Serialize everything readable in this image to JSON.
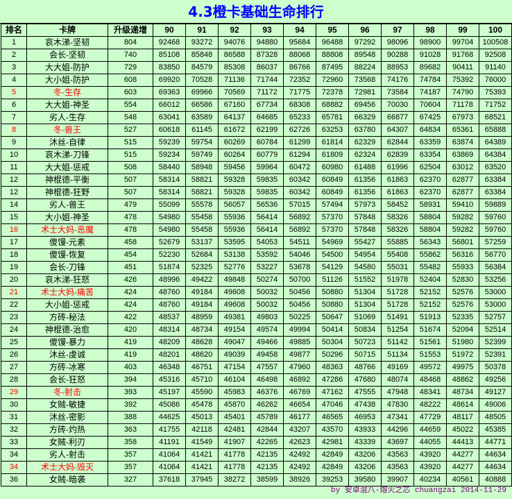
{
  "title": "4.3橙卡基础生命排行",
  "header": [
    "排名",
    "卡牌",
    "升级递增",
    "90",
    "91",
    "92",
    "93",
    "94",
    "95",
    "96",
    "97",
    "98",
    "99",
    "100"
  ],
  "rows": [
    {
      "rank": "1",
      "card": "哀木涕-坚韧",
      "inc": "804",
      "v": [
        "92468",
        "93272",
        "94076",
        "94880",
        "95684",
        "96488",
        "97292",
        "98096",
        "98900",
        "99704",
        "100508"
      ]
    },
    {
      "rank": "2",
      "card": "会长-坚韧",
      "inc": "740",
      "v": [
        "85108",
        "85848",
        "86588",
        "87328",
        "88068",
        "88808",
        "89548",
        "90288",
        "91028",
        "91768",
        "92508"
      ]
    },
    {
      "rank": "3",
      "card": "大大姐-防护",
      "inc": "729",
      "v": [
        "83850",
        "84579",
        "85308",
        "86037",
        "86766",
        "87495",
        "88224",
        "88953",
        "89682",
        "90411",
        "91140"
      ]
    },
    {
      "rank": "4",
      "card": "大小姐-防护",
      "inc": "608",
      "v": [
        "69920",
        "70528",
        "71136",
        "71744",
        "72352",
        "72960",
        "73568",
        "74176",
        "74784",
        "75392",
        "76000"
      ]
    },
    {
      "rank": "5",
      "card": "冬-生存",
      "inc": "603",
      "v": [
        "69363",
        "69966",
        "70569",
        "71172",
        "71775",
        "72378",
        "72981",
        "73584",
        "74187",
        "74790",
        "75393"
      ],
      "red": true
    },
    {
      "rank": "6",
      "card": "大大姐-神圣",
      "inc": "554",
      "v": [
        "66012",
        "66586",
        "67160",
        "67734",
        "68308",
        "68882",
        "69456",
        "70030",
        "70604",
        "71178",
        "71752"
      ]
    },
    {
      "rank": "7",
      "card": "劣人-生存",
      "inc": "548",
      "v": [
        "63041",
        "63589",
        "64137",
        "64685",
        "65233",
        "65781",
        "66329",
        "66877",
        "67425",
        "67973",
        "68521"
      ]
    },
    {
      "rank": "8",
      "card": "冬-兽王",
      "inc": "527",
      "v": [
        "60618",
        "61145",
        "61672",
        "62199",
        "62726",
        "63253",
        "63780",
        "64307",
        "64834",
        "65361",
        "65888"
      ],
      "red": true
    },
    {
      "rank": "9",
      "card": "沐丝-自律",
      "inc": "515",
      "v": [
        "59239",
        "59754",
        "60269",
        "60784",
        "61299",
        "61814",
        "62329",
        "62844",
        "63359",
        "63874",
        "64389"
      ]
    },
    {
      "rank": "10",
      "card": "哀木涕-刀锋",
      "inc": "515",
      "v": [
        "59234",
        "59749",
        "60264",
        "60779",
        "61294",
        "61809",
        "62324",
        "62839",
        "63354",
        "63869",
        "64384"
      ]
    },
    {
      "rank": "11",
      "card": "大大姐-惩戒",
      "inc": "508",
      "v": [
        "58440",
        "58948",
        "59456",
        "59964",
        "60472",
        "60980",
        "61488",
        "61996",
        "62504",
        "63012",
        "63520"
      ]
    },
    {
      "rank": "12",
      "card": "神棍德-平衡",
      "inc": "507",
      "v": [
        "58314",
        "58821",
        "59328",
        "59835",
        "60342",
        "60849",
        "61356",
        "61863",
        "62370",
        "62877",
        "63384"
      ]
    },
    {
      "rank": "12",
      "card": "神棍德-狂野",
      "inc": "507",
      "v": [
        "58314",
        "58821",
        "59328",
        "59835",
        "60342",
        "60849",
        "61356",
        "61863",
        "62370",
        "62877",
        "63384"
      ]
    },
    {
      "rank": "14",
      "card": "劣人-兽王",
      "inc": "479",
      "v": [
        "55099",
        "55578",
        "56057",
        "56536",
        "57015",
        "57494",
        "57973",
        "58452",
        "58931",
        "59410",
        "59889"
      ]
    },
    {
      "rank": "15",
      "card": "大小姐-神圣",
      "inc": "478",
      "v": [
        "54980",
        "55458",
        "55936",
        "56414",
        "56892",
        "57370",
        "57848",
        "58326",
        "58804",
        "59282",
        "59760"
      ]
    },
    {
      "rank": "16",
      "card": "术士大妈-恶魔",
      "inc": "478",
      "v": [
        "54980",
        "55458",
        "55936",
        "56414",
        "56892",
        "57370",
        "57848",
        "58326",
        "58804",
        "59282",
        "59760"
      ],
      "red": true
    },
    {
      "rank": "17",
      "card": "傻馒-元素",
      "inc": "458",
      "v": [
        "52679",
        "53137",
        "53595",
        "54053",
        "54511",
        "54969",
        "55427",
        "55885",
        "56343",
        "56801",
        "57259"
      ]
    },
    {
      "rank": "18",
      "card": "傻馒-恢复",
      "inc": "454",
      "v": [
        "52230",
        "52684",
        "53138",
        "53592",
        "54046",
        "54500",
        "54954",
        "55408",
        "55862",
        "56316",
        "56770"
      ]
    },
    {
      "rank": "19",
      "card": "会长-刀锋",
      "inc": "451",
      "v": [
        "51874",
        "52325",
        "52776",
        "53227",
        "53678",
        "54129",
        "54580",
        "55031",
        "55482",
        "55933",
        "56384"
      ]
    },
    {
      "rank": "20",
      "card": "哀木涕-狂怒",
      "inc": "426",
      "v": [
        "48996",
        "49422",
        "49848",
        "50274",
        "50700",
        "51126",
        "51552",
        "51978",
        "52404",
        "52830",
        "53256"
      ]
    },
    {
      "rank": "21",
      "card": "术士大妈-痛苦",
      "inc": "424",
      "v": [
        "48760",
        "49184",
        "49608",
        "50032",
        "50456",
        "50880",
        "51304",
        "51728",
        "52152",
        "52576",
        "53000"
      ],
      "red": true
    },
    {
      "rank": "22",
      "card": "大小姐-惩戒",
      "inc": "424",
      "v": [
        "48760",
        "49184",
        "49608",
        "50032",
        "50456",
        "50880",
        "51304",
        "51728",
        "52152",
        "52576",
        "53000"
      ]
    },
    {
      "rank": "23",
      "card": "方砖-秘法",
      "inc": "422",
      "v": [
        "48537",
        "48959",
        "49381",
        "49803",
        "50225",
        "50647",
        "51069",
        "51491",
        "51913",
        "52335",
        "52757"
      ]
    },
    {
      "rank": "24",
      "card": "神棍德-治愈",
      "inc": "420",
      "v": [
        "48314",
        "48734",
        "49154",
        "49574",
        "49994",
        "50414",
        "50834",
        "51254",
        "51674",
        "52094",
        "52514"
      ]
    },
    {
      "rank": "25",
      "card": "傻馒-暴力",
      "inc": "419",
      "v": [
        "48209",
        "48628",
        "49047",
        "49466",
        "49885",
        "50304",
        "50723",
        "51142",
        "51561",
        "51980",
        "52399"
      ]
    },
    {
      "rank": "26",
      "card": "沐丝-虔诚",
      "inc": "419",
      "v": [
        "48201",
        "48620",
        "49039",
        "49458",
        "49877",
        "50296",
        "50715",
        "51134",
        "51553",
        "51972",
        "52391"
      ]
    },
    {
      "rank": "27",
      "card": "方砖-冰寒",
      "inc": "403",
      "v": [
        "46348",
        "46751",
        "47154",
        "47557",
        "47960",
        "48363",
        "48766",
        "49169",
        "49572",
        "49975",
        "50378"
      ]
    },
    {
      "rank": "28",
      "card": "会长-狂怒",
      "inc": "394",
      "v": [
        "45316",
        "45710",
        "46104",
        "46498",
        "46892",
        "47286",
        "47680",
        "48074",
        "48468",
        "48862",
        "49256"
      ]
    },
    {
      "rank": "29",
      "card": "冬-射击",
      "inc": "393",
      "v": [
        "45197",
        "45590",
        "45983",
        "46376",
        "46769",
        "47162",
        "47555",
        "47948",
        "48341",
        "48734",
        "49127"
      ],
      "red": true
    },
    {
      "rank": "30",
      "card": "女贼-敏捷",
      "inc": "392",
      "v": [
        "45086",
        "45478",
        "45870",
        "46262",
        "46654",
        "47046",
        "47438",
        "47830",
        "48222",
        "48614",
        "49006"
      ]
    },
    {
      "rank": "31",
      "card": "沐丝-密影",
      "inc": "388",
      "v": [
        "44625",
        "45013",
        "45401",
        "45789",
        "46177",
        "46565",
        "46953",
        "47341",
        "47729",
        "48117",
        "48505"
      ]
    },
    {
      "rank": "32",
      "card": "方砖-灼热",
      "inc": "363",
      "v": [
        "41755",
        "42118",
        "42481",
        "42844",
        "43207",
        "43570",
        "43933",
        "44296",
        "44659",
        "45022",
        "45385"
      ]
    },
    {
      "rank": "33",
      "card": "女贼-利刃",
      "inc": "358",
      "v": [
        "41191",
        "41549",
        "41907",
        "42265",
        "42623",
        "42981",
        "43339",
        "43697",
        "44055",
        "44413",
        "44771"
      ]
    },
    {
      "rank": "34",
      "card": "劣人-射击",
      "inc": "357",
      "v": [
        "41064",
        "41421",
        "41778",
        "42135",
        "42492",
        "42849",
        "43206",
        "43563",
        "43920",
        "44277",
        "44634"
      ]
    },
    {
      "rank": "34",
      "card": "术士大妈-毁灭",
      "inc": "357",
      "v": [
        "41064",
        "41421",
        "41778",
        "42135",
        "42492",
        "42849",
        "43206",
        "43563",
        "43920",
        "44277",
        "44634"
      ],
      "red": true
    },
    {
      "rank": "36",
      "card": "女贼-暗袭",
      "inc": "327",
      "v": [
        "37618",
        "37945",
        "38272",
        "38599",
        "38926",
        "39253",
        "39580",
        "39907",
        "40234",
        "40561",
        "40888"
      ]
    }
  ],
  "footer": "by 安卓混八-熔火之芯 chuangzai 2014-11-29"
}
